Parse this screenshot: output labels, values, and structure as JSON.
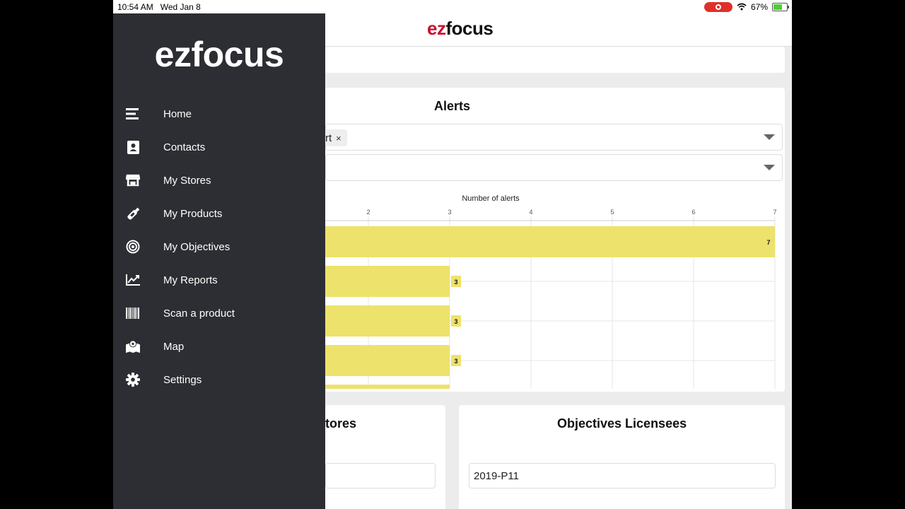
{
  "status_bar": {
    "time": "10:54 AM",
    "date": "Wed Jan 8",
    "battery_percent": "67%",
    "battery_level": 0.67
  },
  "app": {
    "logo_prefix": "ez",
    "logo_suffix": "focus"
  },
  "drawer": {
    "logo": "ezfocus",
    "items": [
      {
        "label": "Home",
        "icon": "home-icon"
      },
      {
        "label": "Contacts",
        "icon": "contacts-icon"
      },
      {
        "label": "My Stores",
        "icon": "store-icon"
      },
      {
        "label": "My Products",
        "icon": "product-icon"
      },
      {
        "label": "My Objectives",
        "icon": "target-icon"
      },
      {
        "label": "My Reports",
        "icon": "chart-line-icon"
      },
      {
        "label": "Scan a product",
        "icon": "barcode-icon"
      },
      {
        "label": "Map",
        "icon": "map-icon"
      },
      {
        "label": "Settings",
        "icon": "gear-icon"
      }
    ]
  },
  "alerts": {
    "title": "Alerts",
    "chip_text": "rt",
    "chip_remove": "×"
  },
  "chart_data": {
    "type": "bar",
    "orientation": "horizontal",
    "xlabel": "Number of alerts",
    "xlim": [
      0,
      7
    ],
    "ticks": [
      2,
      3,
      4,
      5,
      6,
      7
    ],
    "values": [
      7,
      3,
      3,
      3,
      3
    ],
    "value_labels": [
      "7",
      "3",
      "3",
      "3"
    ],
    "bar_color": "#ede26b",
    "grid": true
  },
  "stores_card": {
    "title": "tores"
  },
  "objectives_licensees": {
    "title": "Objectives Licensees",
    "value": "2019-P11"
  },
  "colors": {
    "drawer_bg": "#2d2e33",
    "brand_red": "#c8102e",
    "page_bg": "#ececec"
  }
}
